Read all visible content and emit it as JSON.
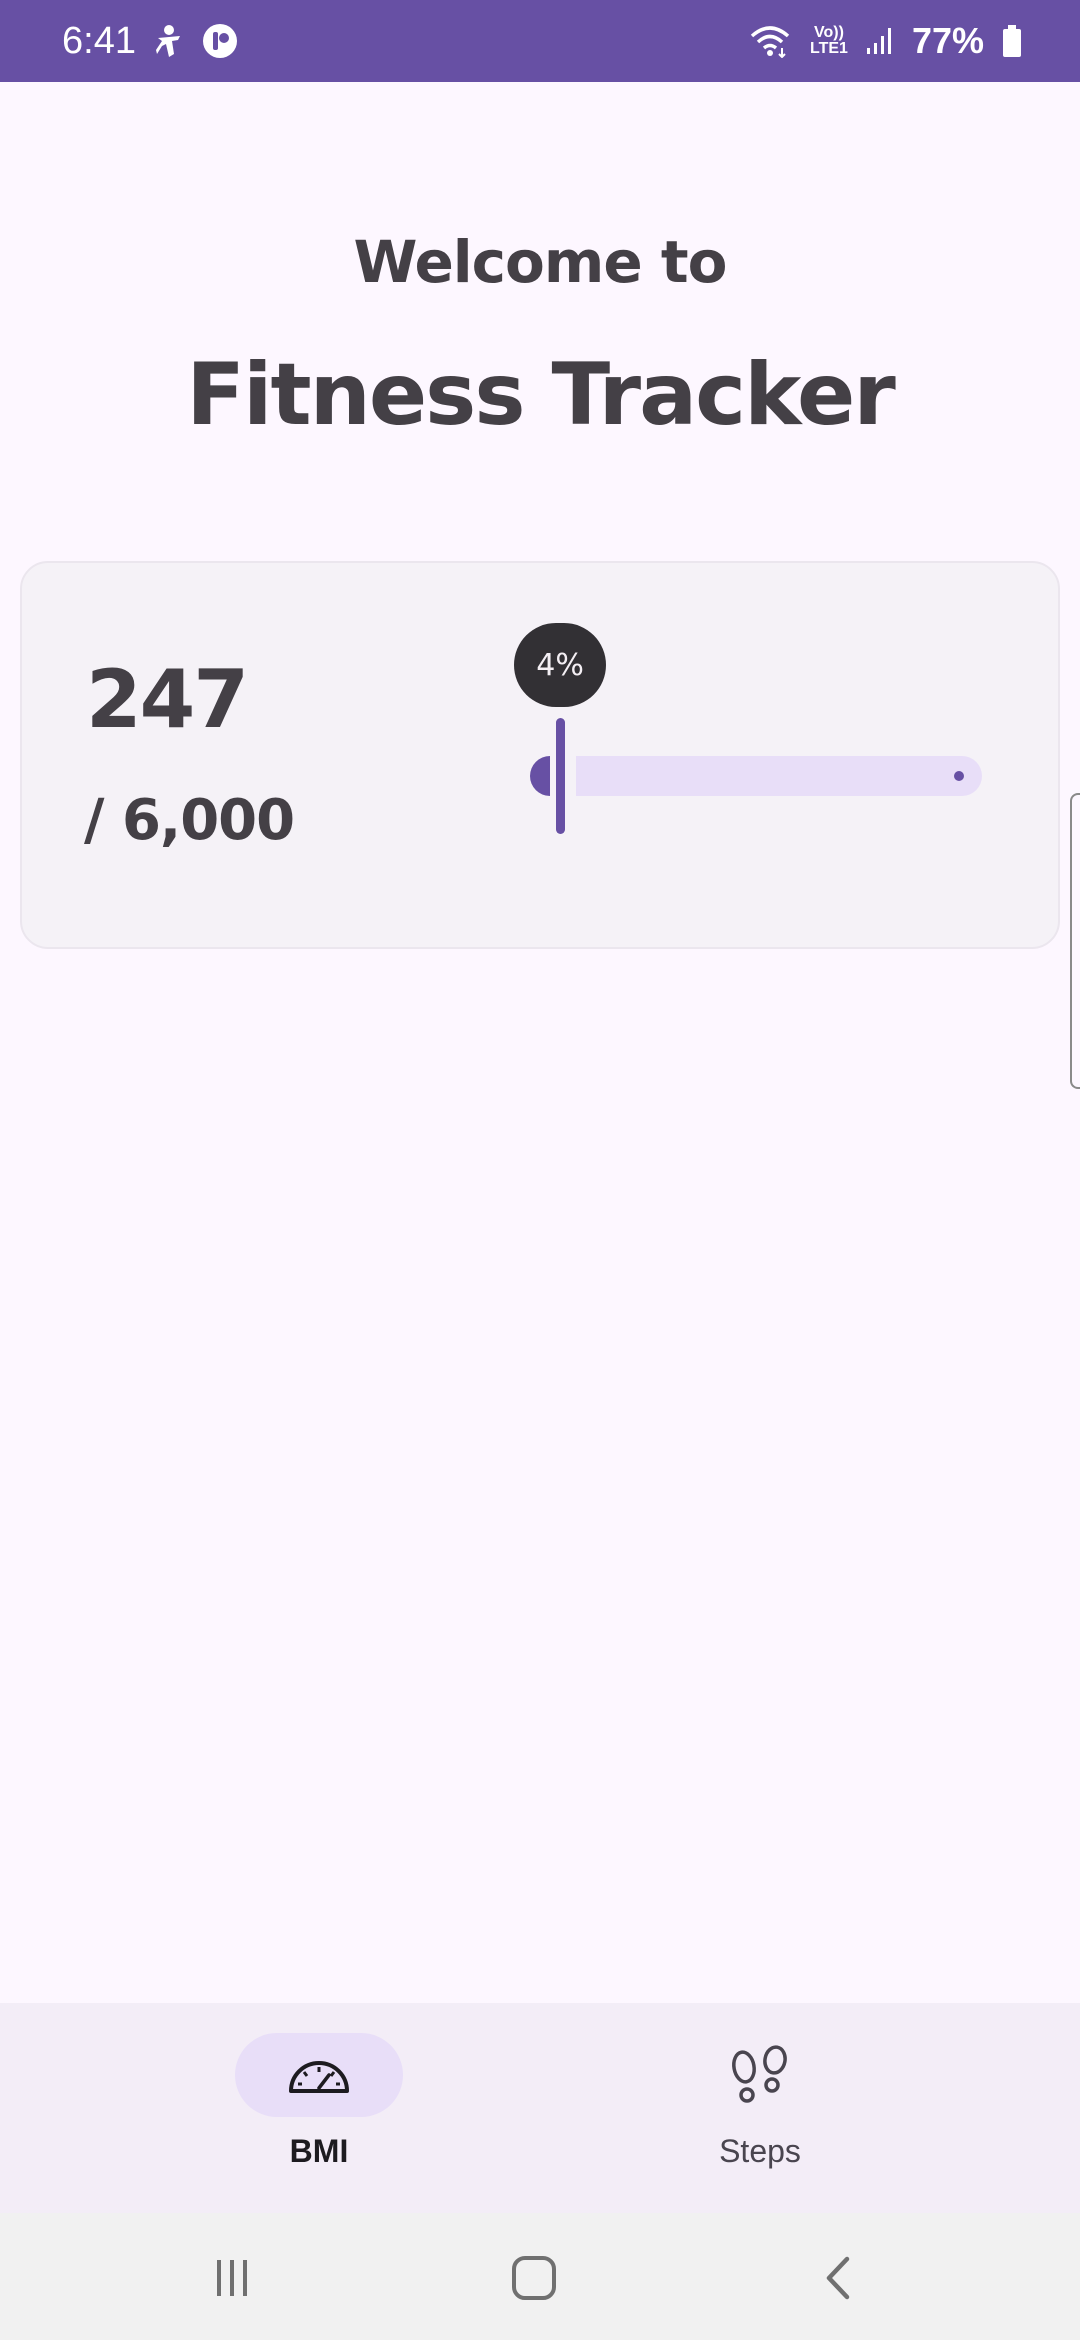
{
  "status_bar": {
    "time": "6:41",
    "lte_label_top": "Vo))",
    "lte_label_bottom": "LTE1",
    "battery_percent": "77%",
    "icons": [
      "accessibility-icon",
      "app-notification-icon",
      "wifi-icon",
      "signal-icon",
      "battery-icon"
    ]
  },
  "header": {
    "welcome": "Welcome to",
    "title": "Fitness Tracker"
  },
  "steps_card": {
    "count": "247",
    "goal": "/ 6,000",
    "progress_label": "4%",
    "progress_fraction": 0.04
  },
  "bottom_nav": {
    "items": [
      {
        "label": "BMI",
        "icon": "speedometer-icon",
        "selected": true
      },
      {
        "label": "Steps",
        "icon": "footprints-icon",
        "selected": false
      }
    ]
  },
  "system_nav": {
    "buttons": [
      "recents-icon",
      "home-icon",
      "back-icon"
    ]
  },
  "colors": {
    "primary": "#6750a4",
    "background": "#fdf7ff",
    "card": "#f5f2f7",
    "track_inactive": "#e8def8",
    "text_dark": "#444046"
  }
}
